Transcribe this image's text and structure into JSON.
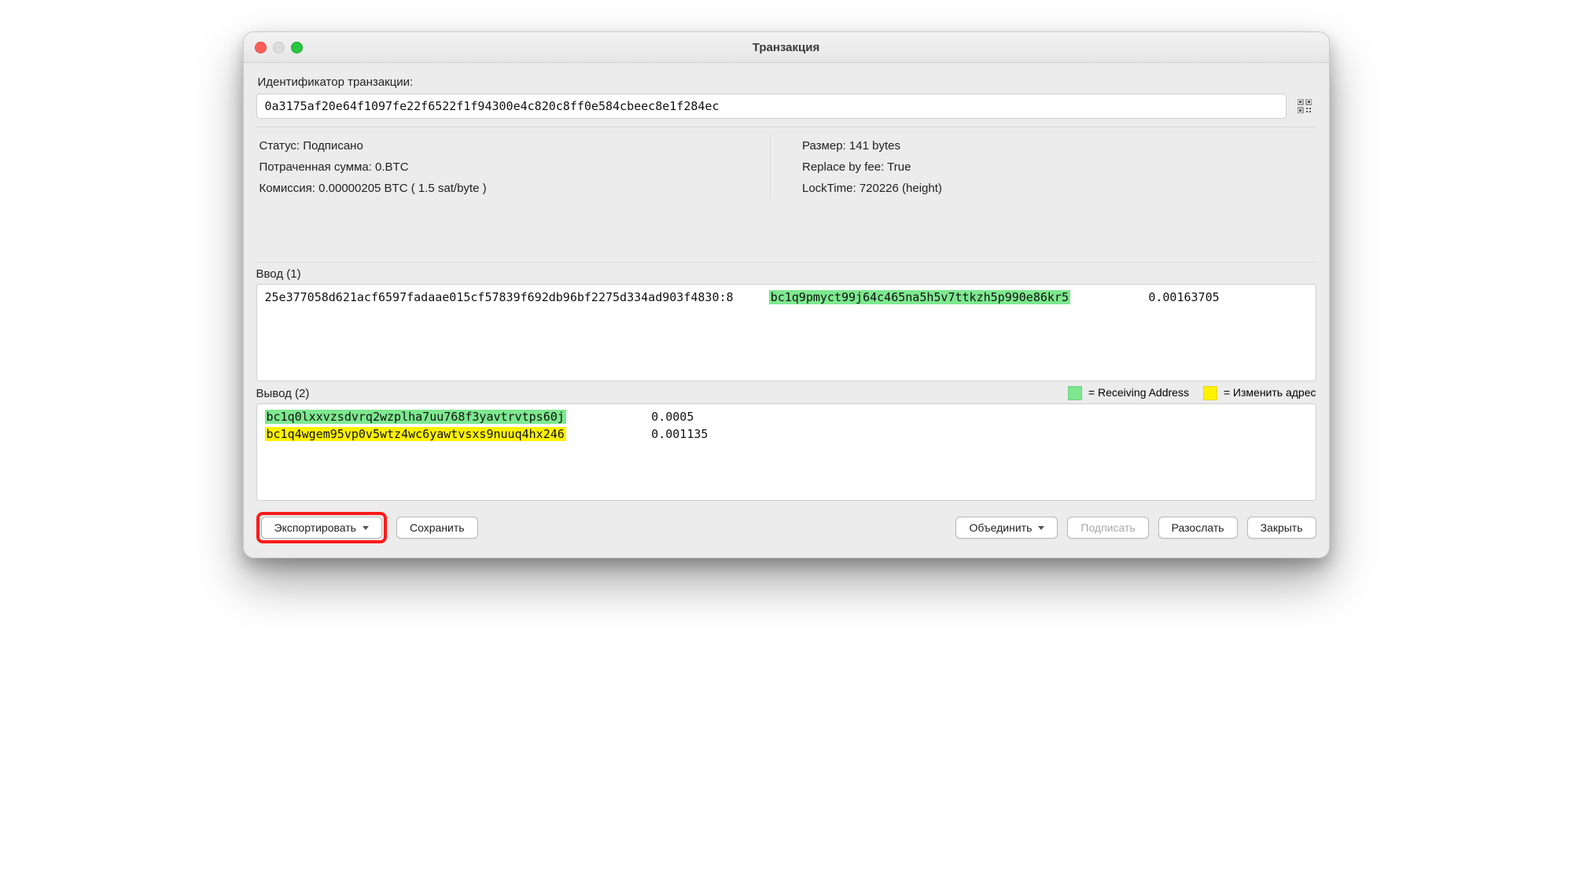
{
  "window": {
    "title": "Транзакция"
  },
  "txid": {
    "label": "Идентификатор транзакции:",
    "value": "0a3175af20e64f1097fe22f6522f1f94300e4c820c8ff0e584cbeec8e1f284ec"
  },
  "meta_left": {
    "status_label": "Статус:",
    "status_value": "Подписано",
    "amount_label": "Потраченная сумма:",
    "amount_value": "0.BTC",
    "fee_label": "Комиссия:",
    "fee_value": "0.00000205 BTC  ( 1.5 sat/byte )"
  },
  "meta_right": {
    "size_label": "Размер:",
    "size_value": "141 bytes",
    "rbf_label": "Replace by fee:",
    "rbf_value": "True",
    "locktime_label": "LockTime:",
    "locktime_value": "720226 (height)"
  },
  "inputs": {
    "title": "Ввод (1)",
    "rows": [
      {
        "prevout": "25e377058d621acf6597fadaae015cf57839f692db96bf2275d334ad903f4830:8",
        "address": "bc1q9pmyct99j64c465na5h5v7ttkzh5p990e86kr5",
        "amount": "0.00163705",
        "addr_class": "green"
      }
    ]
  },
  "outputs": {
    "title": "Вывод (2)",
    "legend_receiving": "= Receiving Address",
    "legend_change": "= Изменить адрес",
    "rows": [
      {
        "address": "bc1q0lxxvzsdvrq2wzplha7uu768f3yavtrvtps60j",
        "amount": "0.0005",
        "addr_class": "green"
      },
      {
        "address": "bc1q4wgem95vp0v5wtz4wc6yawtvsxs9nuuq4hx246",
        "amount": "0.001135",
        "addr_class": "yellow"
      }
    ]
  },
  "buttons": {
    "export": "Экспортировать",
    "save": "Сохранить",
    "combine": "Объединить",
    "sign": "Подписать",
    "broadcast": "Разослать",
    "close": "Закрыть"
  }
}
